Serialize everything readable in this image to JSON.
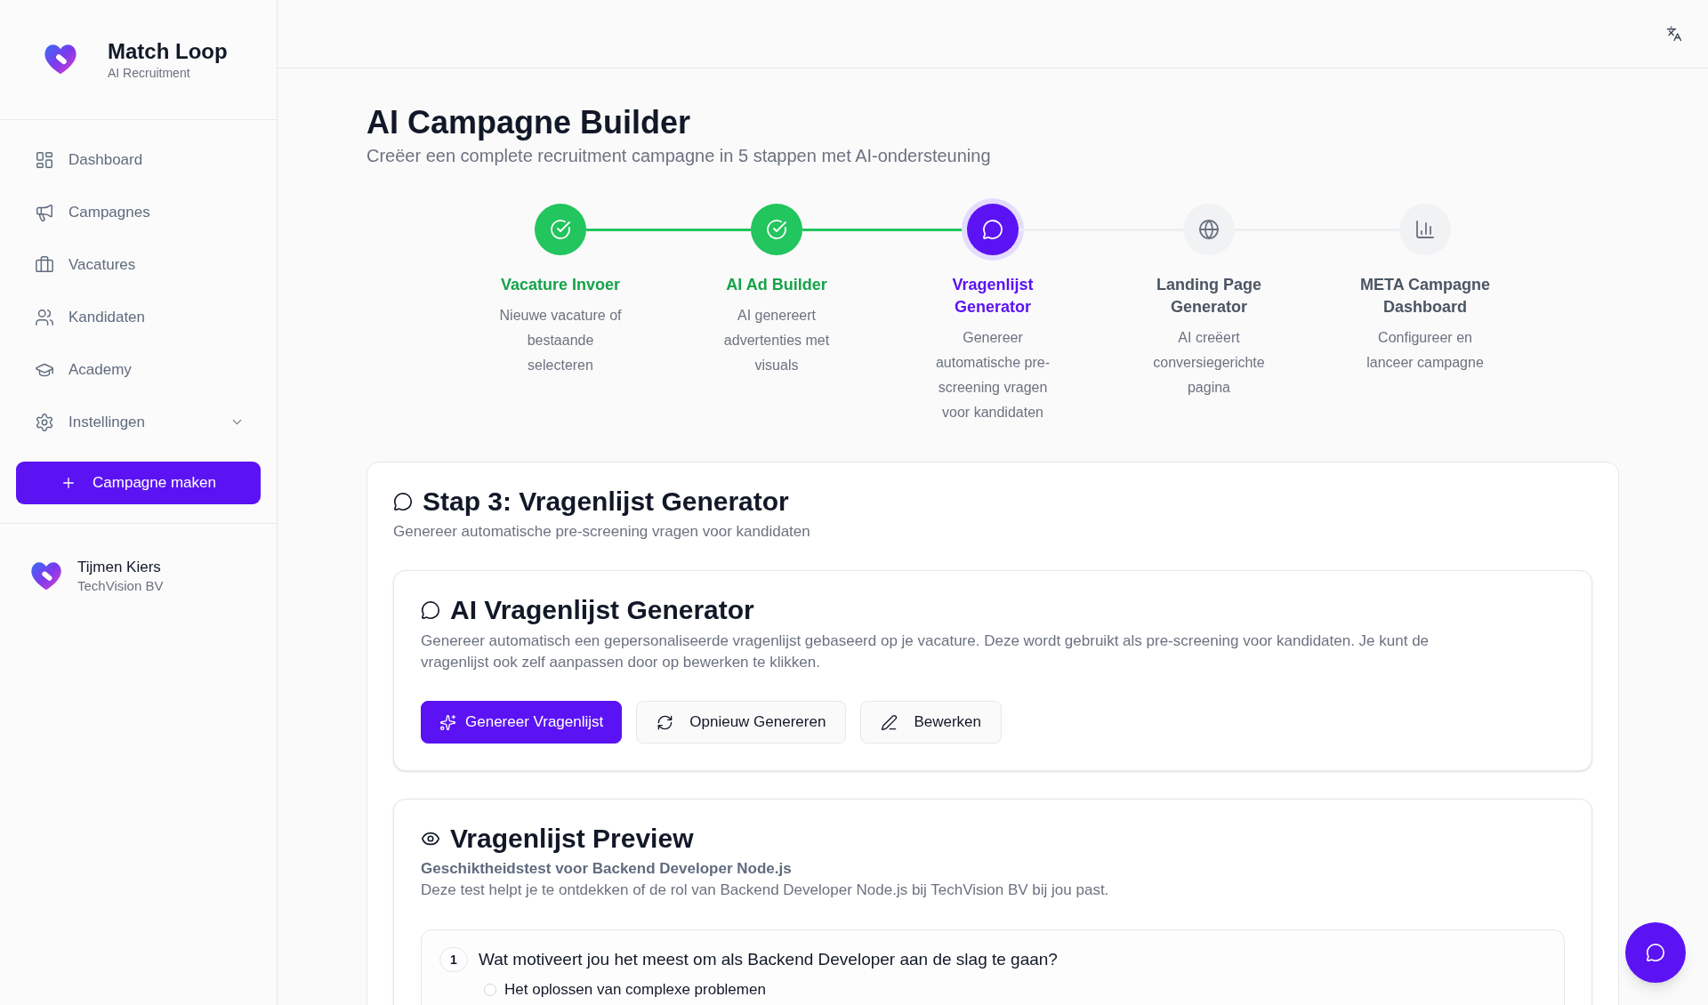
{
  "sidebar": {
    "brand": {
      "name": "Match Loop",
      "tagline": "AI Recruitment"
    },
    "nav": [
      {
        "label": "Dashboard",
        "kind": "link",
        "selected": false
      },
      {
        "label": "Campagnes",
        "kind": "link",
        "selected": false
      },
      {
        "label": "Vacatures",
        "kind": "link",
        "selected": false
      },
      {
        "label": "Kandidaten",
        "kind": "link",
        "selected": false
      },
      {
        "label": "Academy",
        "kind": "link",
        "selected": false
      },
      {
        "label": "Instellingen",
        "kind": "group",
        "selected": false,
        "expanded": false
      }
    ],
    "create_button": "Campagne maken",
    "user": {
      "name": "Tijmen Kiers",
      "company": "TechVision BV"
    }
  },
  "page": {
    "title": "AI Campagne Builder",
    "subtitle": "Creëer een complete recruitment campagne in 5 stappen met AI-ondersteuning"
  },
  "steps": [
    {
      "title": "Vacature Invoer",
      "description": "Nieuwe vacature of bestaande selecteren",
      "completed": true,
      "selected": false
    },
    {
      "title": "AI Ad Builder",
      "description": "AI genereert advertenties met visuals",
      "completed": true,
      "selected": false
    },
    {
      "title": "Vragenlijst Generator",
      "description": "Genereer automatische pre-screening vragen voor kandidaten",
      "completed": false,
      "selected": true
    },
    {
      "title": "Landing Page Generator",
      "description": "AI creëert conversiegerichte pagina",
      "completed": false,
      "selected": false
    },
    {
      "title": "META Campagne Dashboard",
      "description": "Configureer en lanceer campagne",
      "completed": false,
      "selected": false
    }
  ],
  "step_card": {
    "title": "Stap 3: Vragenlijst Generator",
    "subtitle": "Genereer automatische pre-screening vragen voor kandidaten",
    "generator": {
      "title": "AI Vragenlijst Generator",
      "description": "Genereer automatisch een gepersonaliseerde vragenlijst gebaseerd op je vacature. Deze wordt gebruikt als pre-screening voor kandidaten. Je kunt de vragenlijst ook zelf aanpassen door op bewerken te klikken.",
      "buttons": [
        {
          "label": "Genereer Vragenlijst",
          "kind": "primary"
        },
        {
          "label": "Opnieuw Genereren",
          "kind": "outline"
        },
        {
          "label": "Bewerken",
          "kind": "outline"
        }
      ]
    },
    "preview": {
      "title": "Vragenlijst Preview",
      "quiz_title": "Geschiktheidstest voor Backend Developer Node.js",
      "quiz_description": "Deze test helpt je te ontdekken of de rol van Backend Developer Node.js bij TechVision BV bij jou past.",
      "questions": [
        {
          "number": "1",
          "text": "Wat motiveert jou het meest om als Backend Developer aan de slag te gaan?",
          "options": [
            {
              "label": "Het oplossen van complexe problemen",
              "selected": false
            }
          ]
        }
      ]
    }
  }
}
